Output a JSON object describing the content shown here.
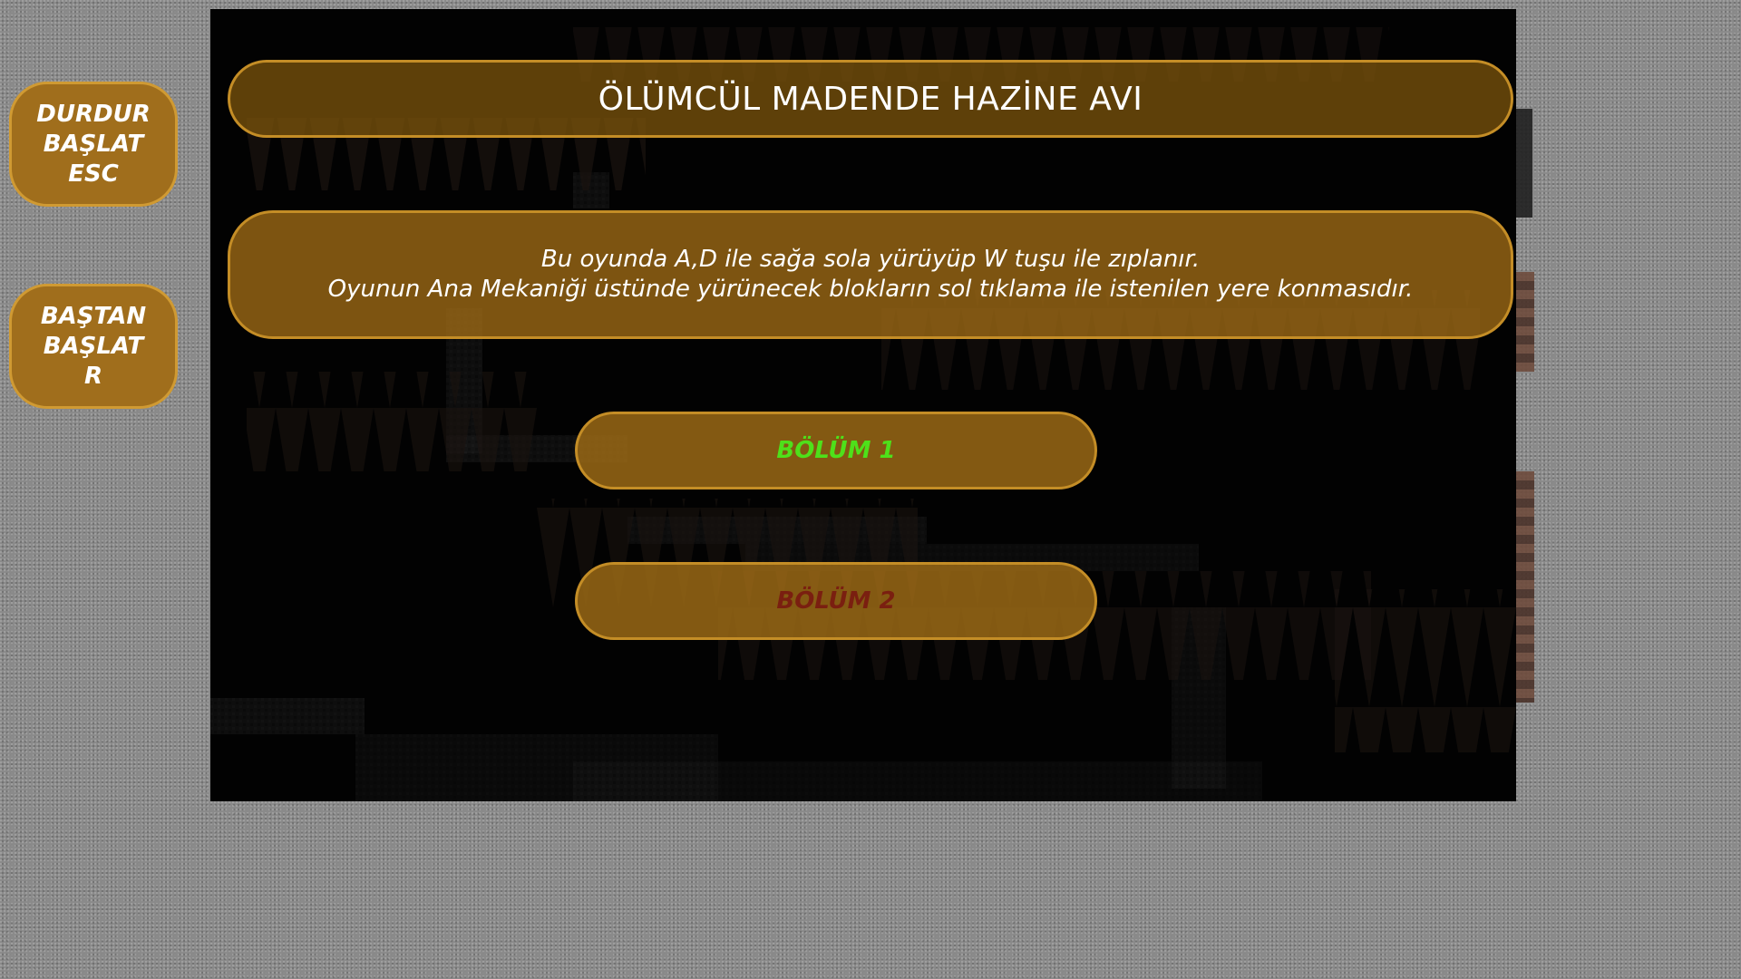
{
  "sidebar": {
    "pause_button": {
      "line1": "DURDUR",
      "line2": "BAŞLAT",
      "line3": "ESC"
    },
    "restart_button": {
      "line1": "BAŞTAN",
      "line2": "BAŞLAT",
      "line3": "R"
    }
  },
  "game": {
    "title": "ÖLÜMCÜL MADENDE HAZİNE AVI",
    "description": {
      "line1": "Bu oyunda A,D ile sağa sola yürüyüp W tuşu ile zıplanır.",
      "line2": "Oyunun Ana Mekaniği üstünde yürünecek blokların sol tıklama ile istenilen yere konmasıdır."
    },
    "levels": [
      {
        "label": "BÖLÜM 1",
        "status": "unlocked",
        "color": "#4ee01a"
      },
      {
        "label": "BÖLÜM 2",
        "status": "locked",
        "color": "#7a1f10"
      }
    ]
  },
  "colors": {
    "button_fill": "#a06e1c",
    "button_border": "#d09a32",
    "background": "#8a8a8a",
    "canvas": "#050505"
  }
}
